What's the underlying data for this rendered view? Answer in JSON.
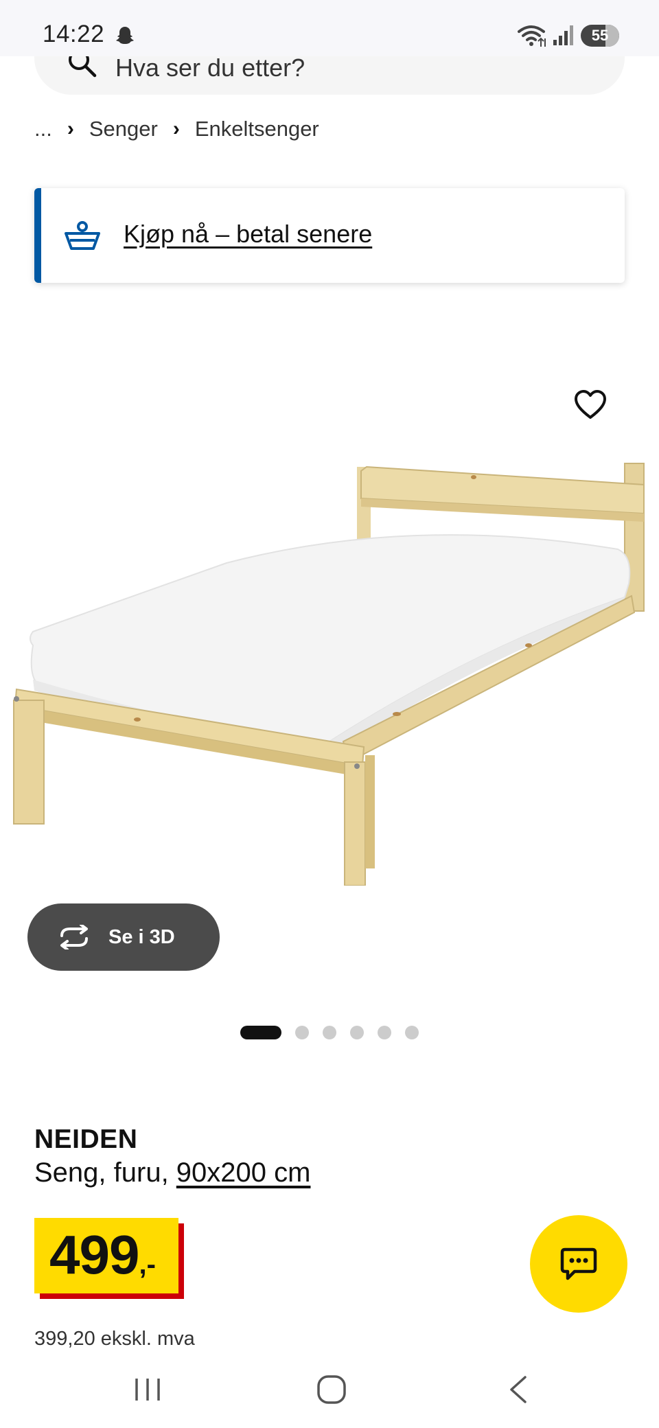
{
  "status_bar": {
    "time": "14:22",
    "battery": "55",
    "icons": [
      "ghost-icon",
      "wifi-icon",
      "signal-icon"
    ]
  },
  "search": {
    "placeholder": "Hva ser du etter?"
  },
  "breadcrumb": {
    "ellipsis": "...",
    "items": [
      "Senger",
      "Enkeltsenger"
    ]
  },
  "promo": {
    "label": "Kjøp nå – betal senere",
    "accent": "#0058a3"
  },
  "gallery": {
    "view3d_label": "Se i 3D",
    "dot_count": 6,
    "active_index": 0
  },
  "product": {
    "name": "NEIDEN",
    "description": "Seng, furu, ",
    "size": "90x200 cm",
    "price": "499",
    "price_suffix": ",-",
    "price_excl_vat": "399,20 ekskl. mva"
  },
  "colors": {
    "price_yellow": "#ffdb00",
    "price_red": "#cc0008",
    "dark_button": "#4b4b4b"
  }
}
